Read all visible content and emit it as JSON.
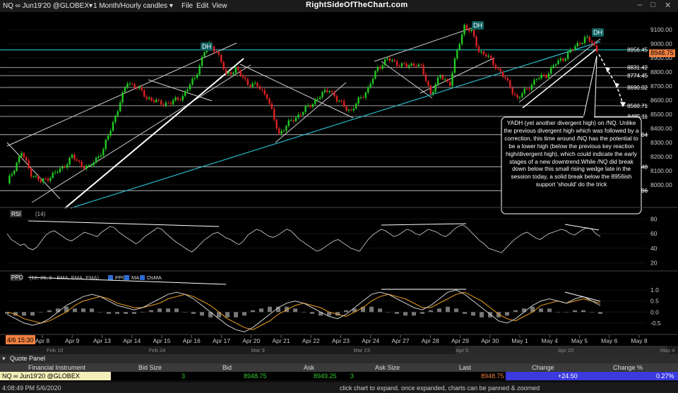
{
  "header": {
    "symbol": "NQ ∞ Jun19'20 @GLOBEX▾",
    "timeframe": "1 Month/Hourly candles ▾",
    "menu": [
      "File",
      "Edit",
      "View"
    ],
    "brand": "RightSideOfTheChart.com",
    "window_icons": "minimize-icon maximize-icon close-icon"
  },
  "chart_data": {
    "type": "candlestick",
    "instrument": "NQ",
    "price_axis": {
      "ticks": [
        "9100.00",
        "9000.00",
        "8900.00",
        "8800.00",
        "8700.00",
        "8600.00",
        "8500.00",
        "8400.00",
        "8300.00",
        "8200.00",
        "8100.00",
        "8000.00"
      ],
      "ylim": [
        7850,
        9175
      ]
    },
    "last_price_label": "8948.75",
    "support_levels": [
      {
        "label": "8956.45",
        "value": 8956.45
      },
      {
        "label": "8831.42",
        "value": 8831.42
      },
      {
        "label": "8774.45",
        "value": 8774.45
      },
      {
        "label": "8690.02",
        "value": 8690.02
      },
      {
        "label": "8560.71",
        "value": 8560.71
      },
      {
        "label": "8485.11",
        "value": 8485.11
      },
      {
        "label": ".04",
        "value": 8356.04
      },
      {
        "label": ".48",
        "value": 8128.48
      },
      {
        "label": ".96",
        "value": 7958.96
      }
    ],
    "x_ticks": [
      "Apr 8",
      "Apr 9",
      "Apr 13",
      "Apr 14",
      "Apr 15",
      "Apr 16",
      "Apr 17",
      "Apr 20",
      "Apr 21",
      "Apr 22",
      "Apr 23",
      "Apr 24",
      "Apr 27",
      "Apr 28",
      "Apr 29",
      "Apr 30",
      "May 1",
      "May 4",
      "May 5",
      "May 6",
      "May 8"
    ],
    "x_start_label": "4/6 15:30",
    "overview_ticks": [
      "Feb 10",
      "Feb 24",
      "Mar 9",
      "Mar 23",
      "Apr 6",
      "Apr 20",
      "May 4"
    ],
    "price_path": [
      [
        0,
        8010
      ],
      [
        6,
        8230
      ],
      [
        10,
        8080
      ],
      [
        14,
        8020
      ],
      [
        18,
        8060
      ],
      [
        23,
        8120
      ],
      [
        27,
        8200
      ],
      [
        31,
        8140
      ],
      [
        34,
        8120
      ],
      [
        40,
        8250
      ],
      [
        45,
        8490
      ],
      [
        50,
        8730
      ],
      [
        54,
        8690
      ],
      [
        58,
        8620
      ],
      [
        63,
        8580
      ],
      [
        68,
        8580
      ],
      [
        73,
        8630
      ],
      [
        78,
        8760
      ],
      [
        82,
        8940
      ],
      [
        84,
        8990
      ],
      [
        87,
        8950
      ],
      [
        91,
        8780
      ],
      [
        95,
        8820
      ],
      [
        100,
        8720
      ],
      [
        104,
        8700
      ],
      [
        108,
        8630
      ],
      [
        111,
        8460
      ],
      [
        113,
        8360
      ],
      [
        116,
        8420
      ],
      [
        120,
        8480
      ],
      [
        125,
        8550
      ],
      [
        130,
        8630
      ],
      [
        134,
        8680
      ],
      [
        137,
        8600
      ],
      [
        140,
        8560
      ],
      [
        143,
        8520
      ],
      [
        146,
        8600
      ],
      [
        150,
        8680
      ],
      [
        154,
        8830
      ],
      [
        158,
        8890
      ],
      [
        162,
        8860
      ],
      [
        166,
        8840
      ],
      [
        170,
        8860
      ],
      [
        172,
        8830
      ],
      [
        176,
        8650
      ],
      [
        180,
        8770
      ],
      [
        184,
        8720
      ],
      [
        187,
        8950
      ],
      [
        190,
        9130
      ],
      [
        193,
        9080
      ],
      [
        196,
        8950
      ],
      [
        199,
        8920
      ],
      [
        202,
        8860
      ],
      [
        205,
        8800
      ],
      [
        208,
        8720
      ],
      [
        212,
        8610
      ],
      [
        216,
        8680
      ],
      [
        220,
        8750
      ],
      [
        224,
        8780
      ],
      [
        228,
        8860
      ],
      [
        232,
        8910
      ],
      [
        236,
        8980
      ],
      [
        240,
        9040
      ],
      [
        243,
        9010
      ],
      [
        245,
        8950
      ]
    ],
    "divergent_high_labels": [
      "DH",
      "DH",
      "DH"
    ],
    "annotation": "YADH (yet another divergent high) on /NQ. Unlike the previous divergent high which was followed by a correction, this time around /NQ has the potential to be a lower high (below the previous key reaction high/divergent high), which could indicate the early stages of a new downtrend.While /NQ did break down below this small rising wedge late in the session today, a solid break below the 8956ish support 'should' do the trick",
    "rsi": {
      "label": "RSI",
      "params": "(14)",
      "ticks": [
        "80",
        "60",
        "40",
        "20"
      ],
      "ylim": [
        12,
        90
      ],
      "values": [
        60,
        52,
        48,
        44,
        46,
        40,
        38,
        42,
        50,
        58,
        62,
        64,
        60,
        56,
        52,
        50,
        54,
        58,
        62,
        60,
        58,
        56,
        62,
        66,
        70,
        68,
        62,
        58,
        54,
        50,
        46,
        50,
        56,
        60,
        64,
        68,
        66,
        60,
        55,
        50,
        46,
        42,
        38,
        35,
        40,
        46,
        52,
        56,
        60,
        62,
        58,
        54,
        52,
        48,
        45,
        50,
        58,
        62,
        66,
        64,
        60,
        56,
        55,
        58,
        62,
        66,
        64,
        58,
        52,
        48,
        44,
        40,
        36,
        38,
        42,
        46,
        50,
        52,
        48,
        44,
        40,
        38,
        36,
        44,
        52,
        58,
        62,
        66,
        64,
        60,
        56,
        58,
        62,
        66,
        64,
        60,
        58,
        62,
        66,
        64,
        62,
        58,
        56,
        60,
        66,
        70,
        72,
        68,
        62,
        56,
        50,
        46,
        40,
        38,
        36,
        34,
        40,
        46,
        52,
        56,
        60,
        62,
        58,
        54,
        52,
        56,
        60,
        62,
        64,
        66,
        64,
        60,
        58,
        62,
        66,
        68,
        66,
        60,
        56
      ]
    },
    "ppo": {
      "label": "PPO",
      "params": "(12, 26, 9 - EMA, EMA, EMA)",
      "legend": [
        "PPO",
        "MA",
        "OsMA"
      ],
      "ticks": [
        "1.0",
        "0.5",
        "0.0",
        "-0.5"
      ],
      "ylim": [
        -0.95,
        1.35
      ],
      "values": [
        -0.1,
        -0.3,
        -0.5,
        -0.6,
        -0.5,
        -0.3,
        0.0,
        0.3,
        0.5,
        0.7,
        0.8,
        0.7,
        0.5,
        0.3,
        0.2,
        0.1,
        0.2,
        0.4,
        0.6,
        0.8,
        0.9,
        0.8,
        0.6,
        0.3,
        0.0,
        -0.3,
        -0.6,
        -0.8,
        -0.9,
        -0.7,
        -0.4,
        -0.1,
        0.2,
        0.4,
        0.5,
        0.4,
        0.2,
        0.0,
        -0.2,
        -0.3,
        -0.1,
        0.2,
        0.5,
        0.8,
        0.9,
        0.8,
        0.6,
        0.4,
        0.2,
        0.1,
        0.3,
        0.6,
        0.9,
        1.0,
        0.8,
        0.5,
        0.2,
        -0.1,
        -0.4,
        -0.5,
        -0.3,
        0.0,
        0.3,
        0.5,
        0.6,
        0.5,
        0.4,
        0.6,
        0.7,
        0.5,
        0.3
      ],
      "ma_values": [
        0.0,
        -0.1,
        -0.3,
        -0.4,
        -0.5,
        -0.4,
        -0.2,
        0.0,
        0.3,
        0.5,
        0.6,
        0.7,
        0.6,
        0.4,
        0.3,
        0.2,
        0.2,
        0.3,
        0.4,
        0.6,
        0.7,
        0.8,
        0.7,
        0.5,
        0.3,
        0.0,
        -0.3,
        -0.5,
        -0.7,
        -0.8,
        -0.6,
        -0.4,
        -0.1,
        0.1,
        0.3,
        0.4,
        0.3,
        0.2,
        0.0,
        -0.1,
        -0.2,
        0.0,
        0.2,
        0.5,
        0.7,
        0.8,
        0.7,
        0.6,
        0.4,
        0.2,
        0.2,
        0.4,
        0.6,
        0.8,
        0.9,
        0.7,
        0.5,
        0.2,
        -0.1,
        -0.3,
        -0.4,
        -0.2,
        0.0,
        0.3,
        0.4,
        0.5,
        0.4,
        0.5,
        0.6,
        0.5,
        0.4
      ]
    }
  },
  "quote_panel": {
    "title": "Quote Panel",
    "columns": [
      "Financial Instrument",
      "Bid Size",
      "Bid",
      "Ask",
      "Ask Size",
      "Last",
      "Change",
      "Change %"
    ],
    "row": {
      "instrument": "NQ ∞ Jun19'20 @GLOBEX",
      "bid_size": "3",
      "bid": "8948.75",
      "ask": "8949.25",
      "ask_size": "3",
      "last": "8948.75",
      "change": "+24.50",
      "change_pct": "0.27%"
    },
    "status_time": "4:08:49 PM 5/6/2020",
    "status_hint": "click chart to expand. once expanded, charts can be panned & zoomed"
  },
  "colors": {
    "bull": "#22cc22",
    "bear": "#dd2222",
    "trendline": "#cfcfcf",
    "cyan_line": "#27b8c8",
    "ppo_line": "#cfcfcf",
    "ppo_ma": "#f0a020",
    "change_bg": "#3a3adf"
  }
}
